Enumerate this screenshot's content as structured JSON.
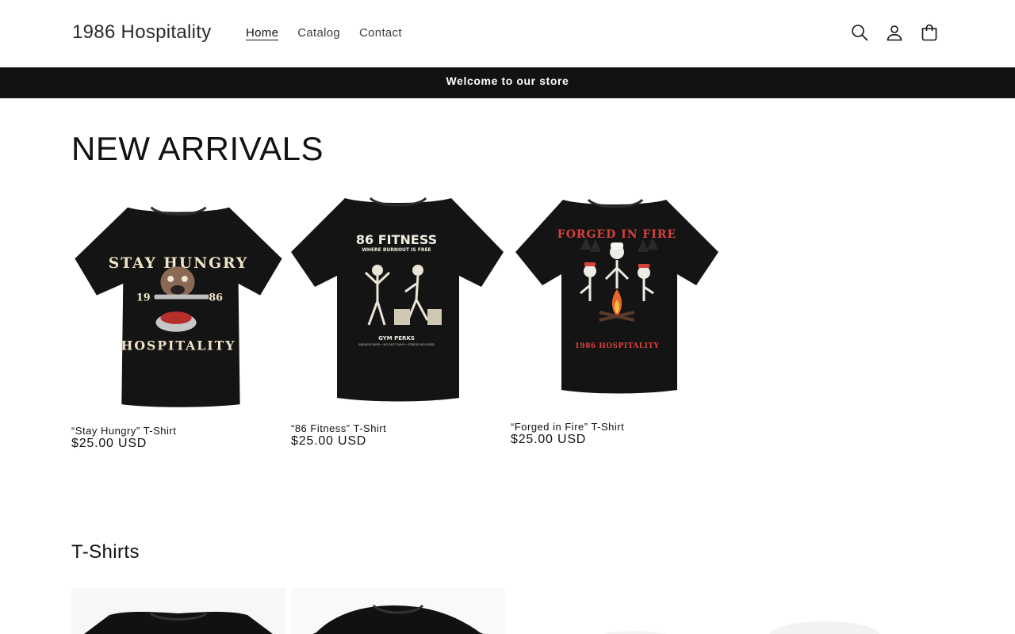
{
  "header": {
    "brand": "1986 Hospitality",
    "nav": [
      {
        "label": "Home"
      },
      {
        "label": "Catalog"
      },
      {
        "label": "Contact"
      }
    ],
    "icons": [
      "search-icon",
      "account-icon",
      "cart-icon"
    ]
  },
  "announcement": {
    "text": "Welcome to our store"
  },
  "new_arrivals": {
    "heading": "NEW ARRIVALS",
    "products": [
      {
        "title": "“Stay Hungry” T-Shirt",
        "price": "$25.00 USD",
        "print_top": "STAY HUNGRY",
        "print_bottom": "HOSPITALITY",
        "print_left": "19",
        "print_right": "86"
      },
      {
        "title": "“86 Fitness” T-Shirt",
        "price": "$25.00 USD",
        "print_title": "86 FITNESS",
        "print_sub": "WHERE BURNOUT IS FREE",
        "print_mid": "GYM PERKS",
        "print_small": "ENDLESS REPS • NO REST DAYS • STRESS INCLUDED"
      },
      {
        "title": "“Forged in Fire” T-Shirt",
        "price": "$25.00 USD",
        "print_title": "FORGED IN FIRE",
        "print_bottom": "1986 HOSPITALITY"
      }
    ]
  },
  "tshirts": {
    "heading": "T-Shirts"
  },
  "colors": {
    "ink": "#121212",
    "shirt": "#141414",
    "cream": "#efe3c6",
    "fire_red": "#d8403a"
  }
}
